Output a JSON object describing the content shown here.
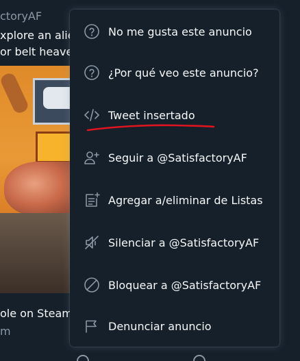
{
  "tweet": {
    "author": "ctoryAF",
    "text_line1": "xplore an alie",
    "text_line2": "or belt heave",
    "footer_text": "ole on Steam",
    "footer_domain": "m"
  },
  "menu": {
    "items": [
      {
        "label": "No me gusta este anuncio",
        "icon": "question-circle-icon"
      },
      {
        "label": "¿Por qué veo este anuncio?",
        "icon": "question-circle-icon"
      },
      {
        "label": "Tweet insertado",
        "icon": "code-embed-icon"
      },
      {
        "label": "Seguir a @SatisfactoryAF",
        "icon": "follow-user-icon"
      },
      {
        "label": "Agregar a/eliminar de Listas",
        "icon": "list-add-icon"
      },
      {
        "label": "Silenciar a @SatisfactoryAF",
        "icon": "mute-icon"
      },
      {
        "label": "Bloquear a @SatisfactoryAF",
        "icon": "block-icon"
      },
      {
        "label": "Denunciar anuncio",
        "icon": "flag-icon"
      }
    ]
  },
  "colors": {
    "background": "#15202b",
    "text_primary": "#f7f9f9",
    "text_secondary": "#8b98a5",
    "annotation_red": "#e0141e"
  }
}
